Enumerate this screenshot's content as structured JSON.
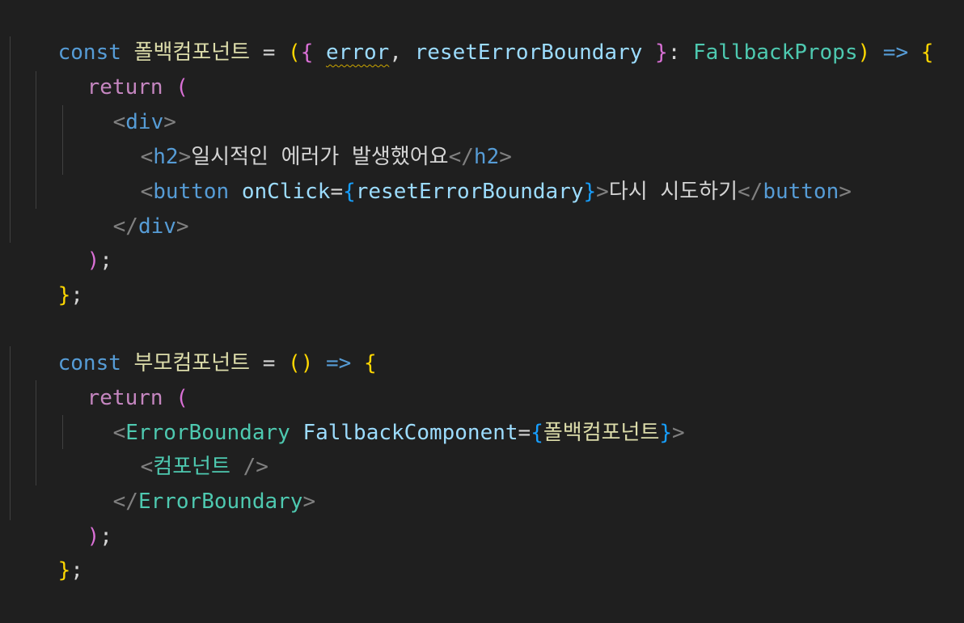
{
  "code": {
    "l1": {
      "const": "const ",
      "name": "폴백컴포넌트",
      "eq": " = ",
      "open_paren": "(",
      "open_brace": "{",
      "sp1": " ",
      "error": "error",
      "comma": ", ",
      "reset": "resetErrorBoundary",
      "sp2": " ",
      "close_brace": "}",
      "colon": ": ",
      "type": "FallbackProps",
      "close_paren": ")",
      "arrow": " => ",
      "body_brace": "{"
    },
    "l2": {
      "return": "return ",
      "paren": "("
    },
    "l3": {
      "lt": "<",
      "tag": "div",
      "gt": ">"
    },
    "l4": {
      "lt": "<",
      "tag": "h2",
      "gt": ">",
      "text": "일시적인 에러가 발생했어요",
      "lt2": "</",
      "tag2": "h2",
      "gt2": ">"
    },
    "l5": {
      "lt": "<",
      "tag": "button",
      "sp": " ",
      "attr": "onClick",
      "eq": "=",
      "ob": "{",
      "val": "resetErrorBoundary",
      "cb": "}",
      "gt": ">",
      "text": "다시 시도하기",
      "lt2": "</",
      "tag2": "button",
      "gt2": ">"
    },
    "l6": {
      "lt": "</",
      "tag": "div",
      "gt": ">"
    },
    "l7": {
      "paren": ")",
      "semi": ";"
    },
    "l8": {
      "brace": "}",
      "semi": ";"
    },
    "l10": {
      "const": "const ",
      "name": "부모컴포넌트",
      "eq": " = ",
      "parens": "()",
      "arrow": " => ",
      "brace": "{"
    },
    "l11": {
      "return": "return ",
      "paren": "("
    },
    "l12": {
      "lt": "<",
      "tag": "ErrorBoundary",
      "sp": " ",
      "attr": "FallbackComponent",
      "eq": "=",
      "ob": "{",
      "val": "폴백컴포넌트",
      "cb": "}",
      "gt": ">"
    },
    "l13": {
      "lt": "<",
      "tag": "컴포넌트",
      "end": " />"
    },
    "l14": {
      "lt": "</",
      "tag": "ErrorBoundary",
      "gt": ">"
    },
    "l15": {
      "paren": ")",
      "semi": ";"
    },
    "l16": {
      "brace": "}",
      "semi": ";"
    }
  }
}
